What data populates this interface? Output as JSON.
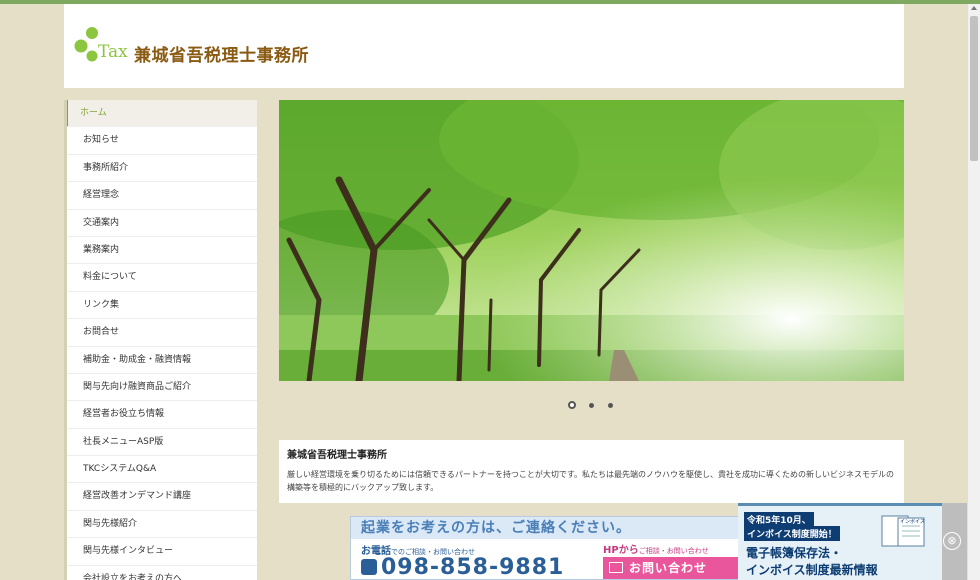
{
  "header": {
    "logo_text": "Tax",
    "title": "兼城省吾税理士事務所"
  },
  "sidebar": {
    "items": [
      {
        "label": "ホーム"
      },
      {
        "label": "お知らせ"
      },
      {
        "label": "事務所紹介"
      },
      {
        "label": "経営理念"
      },
      {
        "label": "交通案内"
      },
      {
        "label": "業務案内"
      },
      {
        "label": "料金について"
      },
      {
        "label": "リンク集"
      },
      {
        "label": "お問合せ"
      },
      {
        "label": "補助金・助成金・融資情報"
      },
      {
        "label": "関与先向け融資商品ご紹介"
      },
      {
        "label": "経営者お役立ち情報"
      },
      {
        "label": "社長メニューASP版"
      },
      {
        "label": "TKCシステムQ&A"
      },
      {
        "label": "経営改善オンデマンド講座"
      },
      {
        "label": "関与先様紹介"
      },
      {
        "label": "関与先様インタビュー"
      },
      {
        "label": "会社設立をお考えの方へ"
      }
    ]
  },
  "slider": {
    "slide_count": 3,
    "active_index": 0
  },
  "intro": {
    "title": "兼城省吾税理士事務所",
    "body": "厳しい経営環境を乗り切るためには信頼できるパートナーを持つことが大切です。私たちは最先端のノウハウを駆使し、貴社を成功に導くための新しいビジネスモデルの構築等を積極的にバックアップ致します。"
  },
  "contact": {
    "heading": "起業をお考えの方は、ご連絡ください。",
    "phone_label": "お電話",
    "phone_sub": "でのご相談・お問い合わせ",
    "phone": "098-858-9881",
    "hp_label": "HPから",
    "hp_sub": "ご相談・お問い合わせ",
    "button": "お問い合わせ"
  },
  "ad": {
    "line1": "令和5年10月、",
    "line2": "インボイス制度開始！",
    "doc_label": "インボイス",
    "text1": "電子帳簿保存法・",
    "text2": "インボイス制度最新情報",
    "close_icon": "⊗"
  },
  "colors": {
    "accent": "#82a23a",
    "title_brown": "#8a5a12",
    "background": "#e5dfc7",
    "topbar": "#7fa860"
  }
}
